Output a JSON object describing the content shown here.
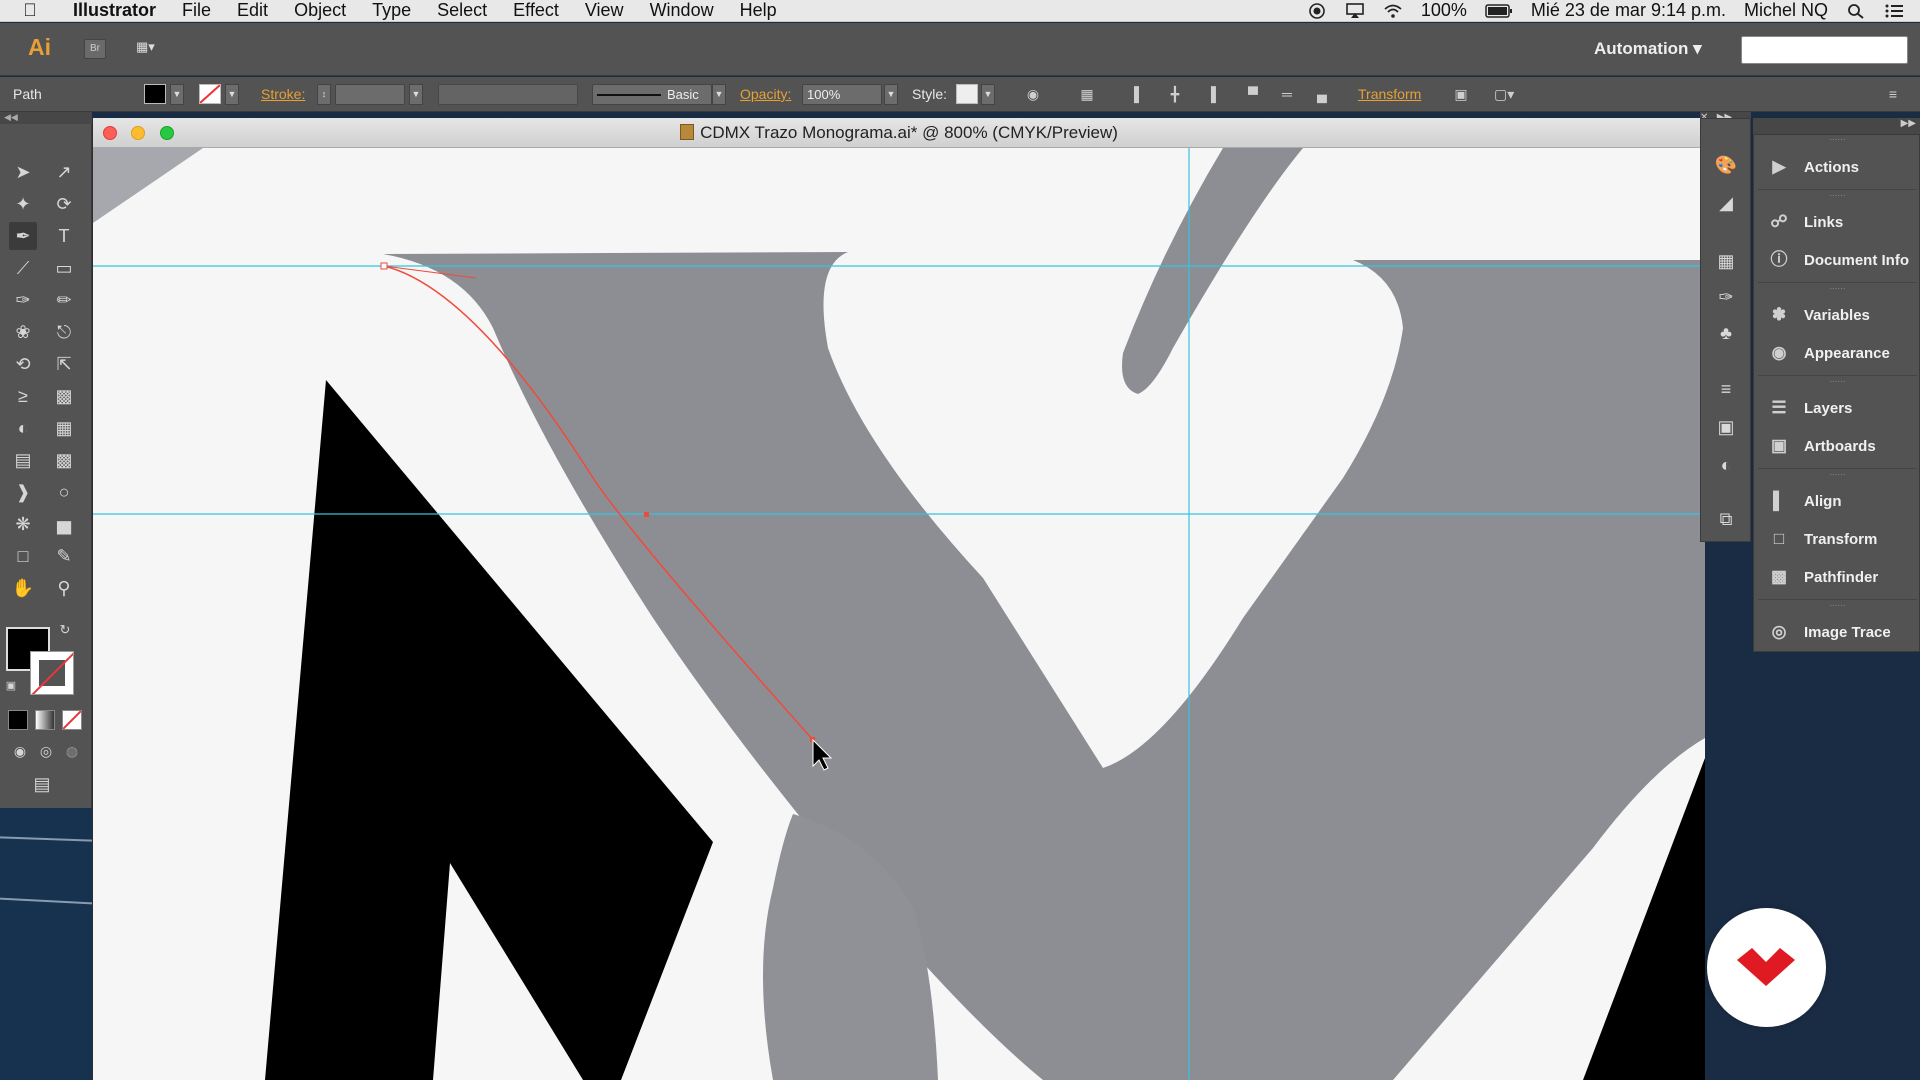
{
  "menubar": {
    "app_name": "Illustrator",
    "items": [
      "File",
      "Edit",
      "Object",
      "Type",
      "Select",
      "Effect",
      "View",
      "Window",
      "Help"
    ],
    "battery": "100%",
    "datetime": "Mié 23 de mar  9:14 p.m.",
    "user": "Michel NQ"
  },
  "appbar": {
    "logo": "Ai",
    "bridge": "Br",
    "workspace": "Automation"
  },
  "control": {
    "selection_type": "Path",
    "stroke_label": "Stroke:",
    "brush_label": "Basic",
    "opacity_label": "Opacity:",
    "opacity_value": "100%",
    "style_label": "Style:",
    "transform_label": "Transform"
  },
  "document": {
    "title": "CDMX Trazo Monograma.ai* @ 800% (CMYK/Preview)"
  },
  "panels": [
    {
      "label": "Actions",
      "icon": "play-icon"
    },
    {
      "label": "Links",
      "icon": "link-icon"
    },
    {
      "label": "Document Info",
      "icon": "info-icon"
    },
    {
      "label": "Variables",
      "icon": "variables-icon"
    },
    {
      "label": "Appearance",
      "icon": "appearance-icon"
    },
    {
      "label": "Layers",
      "icon": "layers-icon"
    },
    {
      "label": "Artboards",
      "icon": "artboards-icon"
    },
    {
      "label": "Align",
      "icon": "align-icon"
    },
    {
      "label": "Transform",
      "icon": "transform-icon"
    },
    {
      "label": "Pathfinder",
      "icon": "pathfinder-icon"
    },
    {
      "label": "Image Trace",
      "icon": "image-trace-icon"
    }
  ],
  "colors": {
    "accent": "#e7a035",
    "guide": "#33c4e0",
    "path": "#f04a3a",
    "panel": "#535353"
  }
}
